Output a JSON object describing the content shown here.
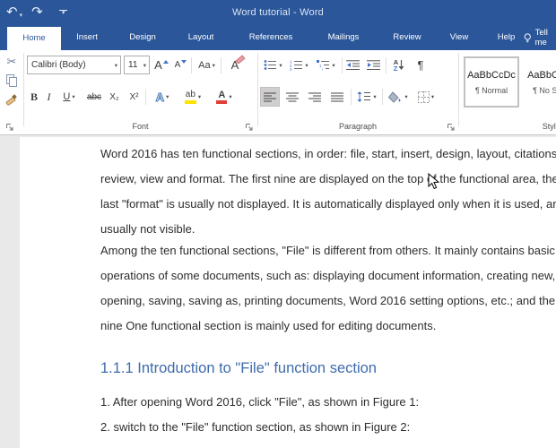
{
  "titlebar": {
    "title": "Word tutorial  -  Word"
  },
  "tabs": [
    {
      "label": "Home"
    },
    {
      "label": "Insert"
    },
    {
      "label": "Design"
    },
    {
      "label": "Layout"
    },
    {
      "label": "References"
    },
    {
      "label": "Mailings"
    },
    {
      "label": "Review"
    },
    {
      "label": "View"
    },
    {
      "label": "Help"
    },
    {
      "label": "Tell me"
    }
  ],
  "ribbon": {
    "font": {
      "label": "Font",
      "font_name": "Calibri (Body)",
      "font_size": "11",
      "grow_font": "A",
      "shrink_font": "A",
      "change_case": "Aa",
      "clear_format": "A",
      "bold": "B",
      "italic": "I",
      "underline": "U",
      "strikethrough": "abc",
      "subscript": "X₂",
      "superscript": "X²",
      "text_effects": "A",
      "highlight": "ab",
      "font_color": "A"
    },
    "paragraph": {
      "label": "Paragraph",
      "sort_a": "A",
      "sort_z": "Z",
      "pilcrow": "¶"
    },
    "styles": {
      "label": "Styles",
      "items": [
        {
          "preview": "AaBbCcDc",
          "name": "¶ Normal"
        },
        {
          "preview": "AaBbCcDc",
          "name": "¶ No Spac"
        }
      ]
    }
  },
  "document": {
    "paragraph1": {
      "lines": [
        "Word 2016 has ten functional sections, in order: file, start, insert, design, layout, citations,",
        "review, view and format. The first nine are displayed on the top of the functional area, the",
        "last \"format\" is usually not displayed. It is automatically displayed only when it is used, and",
        "usually not visible."
      ]
    },
    "paragraph2": {
      "lines": [
        "Among the ten functional sections, \"File\" is different from others. It mainly contains basic",
        "operations of some documents, such as: displaying document information, creating new,",
        "opening, saving, saving as, printing documents, Word 2016 setting options, etc.; and the",
        "nine One functional section is mainly used for editing documents."
      ]
    },
    "heading": "1.1.1 Introduction to \"File\" function section",
    "list": [
      "1. After opening Word 2016, click \"File\", as shown in Figure 1:",
      "2. switch to the \"File\" function section, as shown in Figure 2:"
    ]
  },
  "colors": {
    "titlebar_blue": "#2b579a",
    "heading_blue": "#3e6bad",
    "highlight_yellow": "#ffe400",
    "font_color_red": "#e03e36",
    "selected_gray": "#d0cece"
  }
}
